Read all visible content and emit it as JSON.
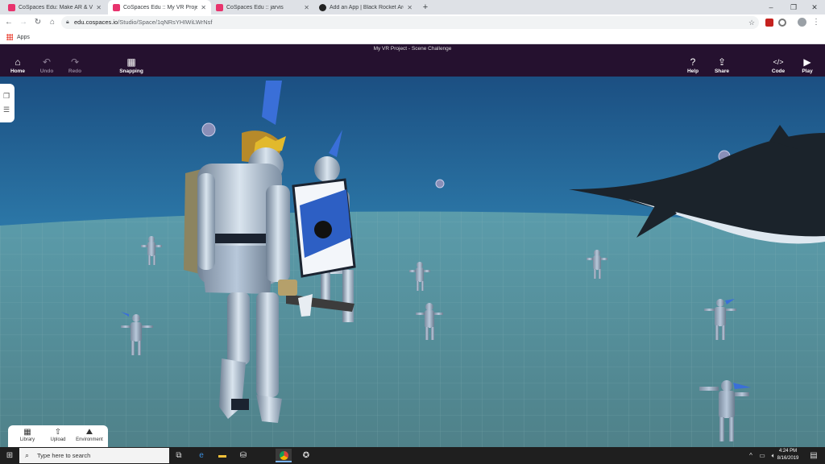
{
  "browser": {
    "tabs": [
      {
        "title": "CoSpaces Edu: Make AR & VR in...",
        "favicon": "cospaces-icon",
        "active": false
      },
      {
        "title": "CoSpaces Edu :: My VR Project",
        "favicon": "cospaces-icon",
        "active": true
      },
      {
        "title": "CoSpaces Edu :: jarvis",
        "favicon": "cospaces-icon",
        "active": false
      },
      {
        "title": "Add an App | Black Rocket Arcad...",
        "favicon": "black-rocket-icon",
        "active": false
      }
    ],
    "new_tab": "+",
    "window_controls": {
      "minimize": "–",
      "restore": "❐",
      "close": "✕"
    },
    "url_host": "edu.cospaces.io",
    "url_path": "/Studio/Space/1qNRsYHIWiLWrNsf",
    "bookmarks_label": "Apps"
  },
  "app": {
    "scene_title": "My VR Project - Scene Challenge",
    "left_buttons": [
      {
        "label": "Home",
        "icon": "home-icon"
      },
      {
        "label": "Undo",
        "icon": "undo-icon"
      },
      {
        "label": "Redo",
        "icon": "redo-icon"
      },
      {
        "label": "Snapping",
        "icon": "grid-icon"
      }
    ],
    "right_buttons": [
      {
        "label": "Help",
        "icon": "help-icon"
      },
      {
        "label": "Share",
        "icon": "share-icon"
      },
      {
        "label": "Code",
        "icon": "code-icon"
      },
      {
        "label": "Play",
        "icon": "play-icon"
      }
    ],
    "bottom_buttons": [
      {
        "label": "Library",
        "icon": "library-icon"
      },
      {
        "label": "Upload",
        "icon": "upload-icon"
      },
      {
        "label": "Environment",
        "icon": "environment-icon"
      }
    ]
  },
  "taskbar": {
    "search_placeholder": "Type here to search",
    "time": "4:24 PM",
    "date": "8/16/2019"
  },
  "colors": {
    "app_header": "#25112f",
    "water": "#1e5f94",
    "floor": "#5a8e98"
  }
}
